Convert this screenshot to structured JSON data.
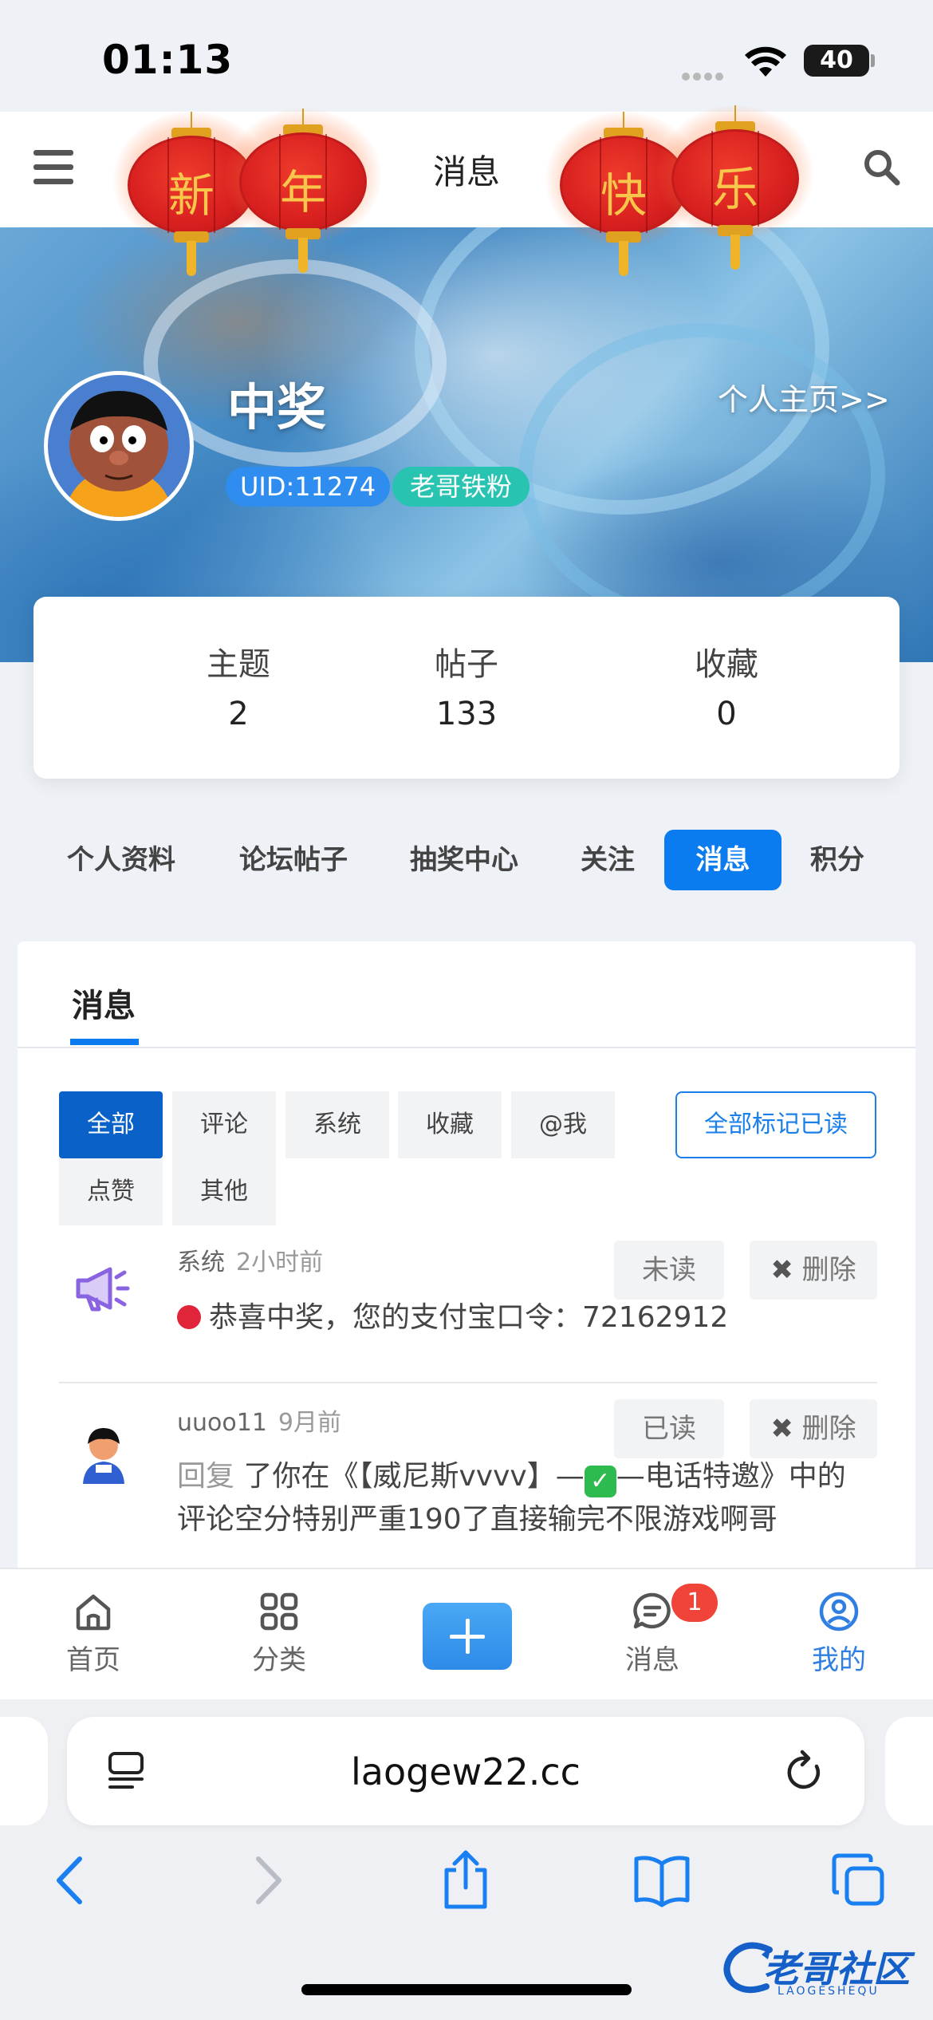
{
  "status_bar": {
    "time": "01:13",
    "battery": "40"
  },
  "header": {
    "title": "消息",
    "lantern_chars": [
      "新",
      "年",
      "快",
      "乐"
    ]
  },
  "profile": {
    "name": "中奖",
    "uid": "UID:11274",
    "badge": "老哥铁粉",
    "home_link": "个人主页>>"
  },
  "stats": [
    {
      "label": "主题",
      "value": "2"
    },
    {
      "label": "帖子",
      "value": "133"
    },
    {
      "label": "收藏",
      "value": "0"
    }
  ],
  "profile_tabs": [
    "个人资料",
    "论坛帖子",
    "抽奖中心",
    "关注",
    "消息",
    "积分"
  ],
  "active_profile_tab": "消息",
  "panel": {
    "tab": "消息",
    "filters": [
      "全部",
      "评论",
      "系统",
      "收藏",
      "@我",
      "点赞",
      "其他"
    ],
    "active_filter": "全部",
    "mark_all_read": "全部标记已读"
  },
  "messages": [
    {
      "sender": "系统",
      "time": "2小时前",
      "status_btn": "未读",
      "delete_btn": "删除",
      "text": "恭喜中奖，您的支付宝口令：72162912"
    },
    {
      "sender": "uuoo11",
      "time": "9月前",
      "status_btn": "已读",
      "delete_btn": "删除",
      "reply_word": "回复",
      "text_part1": "了你在《【威尼斯vvvv】—",
      "text_part2": "—电话特邀》中的",
      "text_line2": "评论空分特别严重190了直接输完不限游戏啊哥"
    }
  ],
  "bottom_nav": [
    {
      "label": "首页",
      "icon": "home-icon"
    },
    {
      "label": "分类",
      "icon": "grid-icon"
    },
    {
      "label": "消息",
      "icon": "chat-icon",
      "badge": "1"
    },
    {
      "label": "我的",
      "icon": "user-icon"
    }
  ],
  "browser": {
    "url": "laogew22.cc"
  },
  "watermark": {
    "text": "老哥社区",
    "sub": "LAOGESHEQU"
  },
  "colors": {
    "accent": "#0a7cf0",
    "badge_red": "#f04438",
    "fan_badge": "#29c3b2"
  }
}
